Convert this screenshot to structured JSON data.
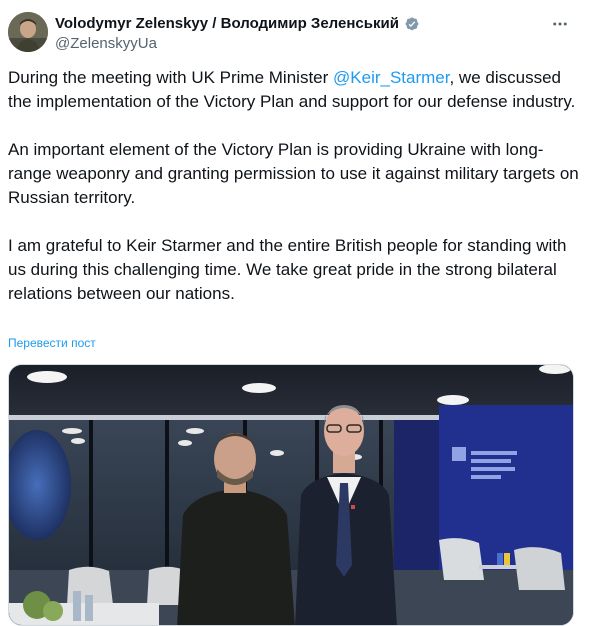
{
  "author": {
    "display_name": "Volodymyr Zelenskyy / Володимир Зеленський",
    "handle": "@ZelenskyyUa",
    "verified_icon": "verified-badge-icon",
    "verified_color": "#829aab"
  },
  "tweet": {
    "para1_before": "During the meeting with UK Prime Minister ",
    "para1_mention": "@Keir_Starmer",
    "para1_after": ", we discussed the implementation of the Victory Plan and support for our defense industry.",
    "para2": "An important element of the Victory Plan is providing Ukraine with long-range weaponry and granting permission to use it against military targets on Russian territory.",
    "para3": "I am grateful to Keir Starmer and the entire British people for standing with us during this challenging time. We take great pride in the strong bilateral relations between our nations.",
    "translate_label": "Перевести пост"
  },
  "colors": {
    "link": "#1d9bf0",
    "text": "#0f1419",
    "secondary": "#536471"
  },
  "icons": {
    "more": "more-horizontal-icon"
  }
}
